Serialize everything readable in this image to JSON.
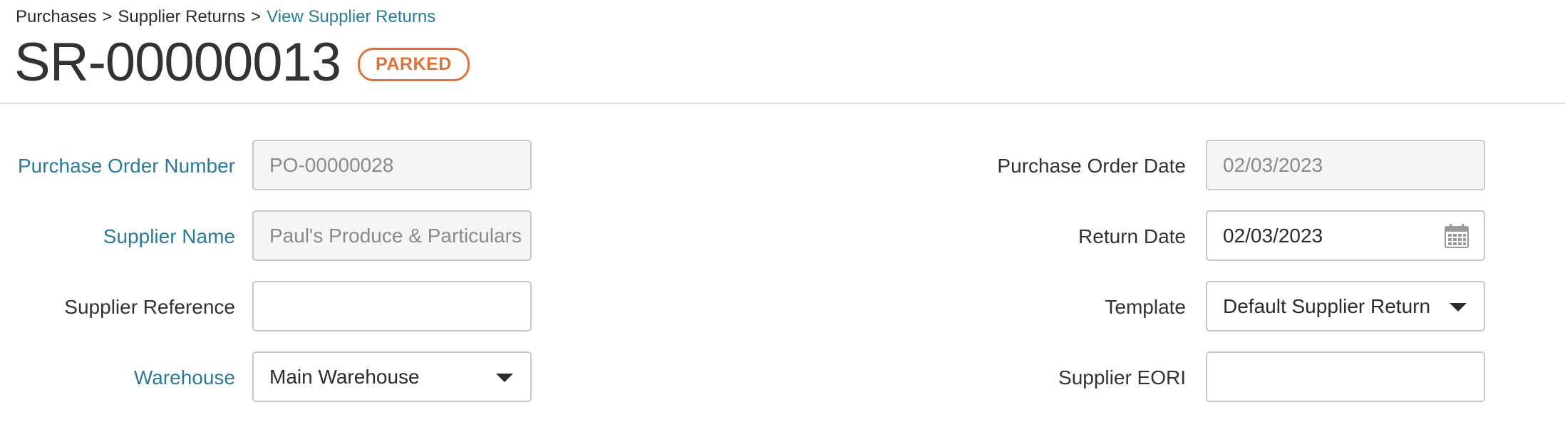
{
  "breadcrumb": {
    "items": [
      "Purchases",
      "Supplier Returns"
    ],
    "current": "View Supplier Returns",
    "separator": ">"
  },
  "header": {
    "title": "SR-00000013",
    "status": "PARKED"
  },
  "colors": {
    "accent_link": "#2a7a9b",
    "status_parked": "#e0713a",
    "readonly_bg": "#f4f5f6",
    "border": "#c9c9c9"
  },
  "form": {
    "purchase_order_number": {
      "label": "Purchase Order Number",
      "value": "PO-00000028"
    },
    "supplier_name": {
      "label": "Supplier Name",
      "value": "Paul's Produce & Particulars"
    },
    "supplier_reference": {
      "label": "Supplier Reference",
      "value": ""
    },
    "warehouse": {
      "label": "Warehouse",
      "value": "Main Warehouse"
    },
    "purchase_order_date": {
      "label": "Purchase Order Date",
      "value": "02/03/2023"
    },
    "return_date": {
      "label": "Return Date",
      "value": "02/03/2023"
    },
    "template": {
      "label": "Template",
      "value": "Default Supplier Return"
    },
    "supplier_eori": {
      "label": "Supplier EORI",
      "value": ""
    }
  },
  "icons": {
    "dropdown": "caret-down-icon",
    "calendar": "calendar-icon"
  }
}
